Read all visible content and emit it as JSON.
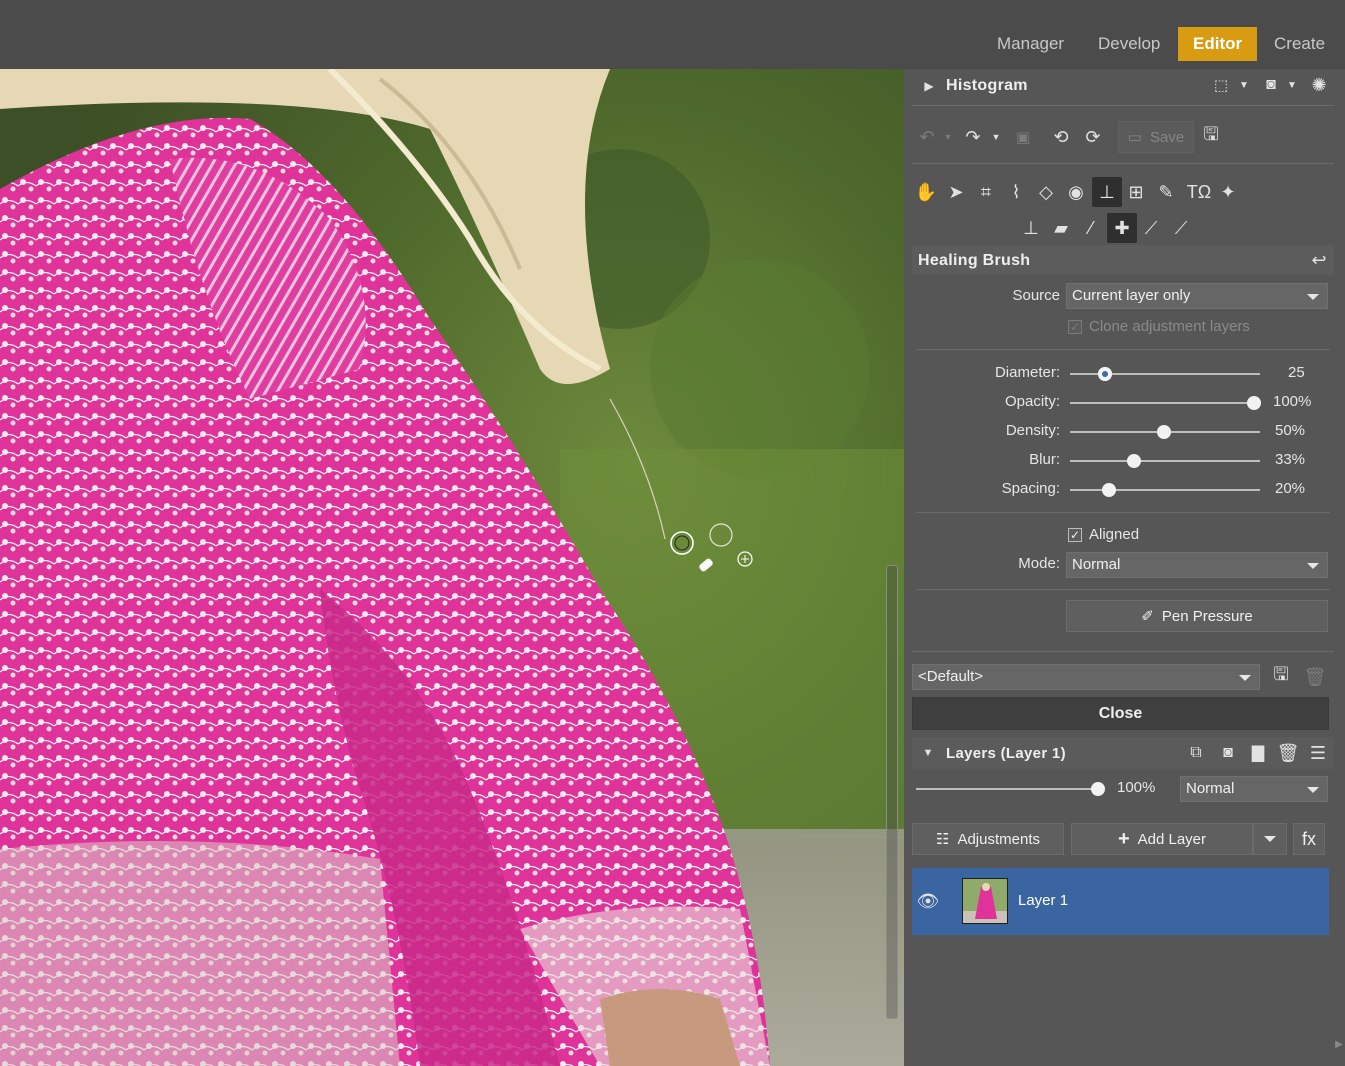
{
  "modes": [
    {
      "label": "Manager",
      "active": false
    },
    {
      "label": "Develop",
      "active": false
    },
    {
      "label": "Editor",
      "active": true
    },
    {
      "label": "Create",
      "active": false
    }
  ],
  "histogram": {
    "title": "Histogram"
  },
  "toolbar": {
    "save_label": "Save"
  },
  "tool_panel": {
    "title": "Healing Brush",
    "source_label": "Source",
    "source_value": "Current layer only",
    "clone_adjustment_label": "Clone adjustment layers",
    "clone_adjustment_checked": true,
    "sliders": [
      {
        "label": "Diameter:",
        "value": "25",
        "fraction": 0.18
      },
      {
        "label": "Opacity:",
        "value": "100%",
        "fraction": 1.0
      },
      {
        "label": "Density:",
        "value": "50%",
        "fraction": 0.5
      },
      {
        "label": "Blur:",
        "value": "33%",
        "fraction": 0.33
      },
      {
        "label": "Spacing:",
        "value": "20%",
        "fraction": 0.2
      }
    ],
    "aligned_label": "Aligned",
    "aligned_checked": true,
    "mode_label": "Mode:",
    "mode_value": "Normal",
    "pen_pressure_label": "Pen Pressure",
    "preset_value": "<Default>",
    "close_label": "Close"
  },
  "layers": {
    "title": "Layers (Layer 1)",
    "opacity": "100%",
    "blend_mode": "Normal",
    "adjustments_label": "Adjustments",
    "add_layer_label": "Add Layer",
    "fx_label": "fx",
    "items": [
      {
        "name": "Layer 1",
        "visible": true,
        "selected": true
      }
    ]
  },
  "colors": {
    "accent": "#d89b12",
    "selection": "#3a65a0",
    "dress": "#e0339a"
  }
}
